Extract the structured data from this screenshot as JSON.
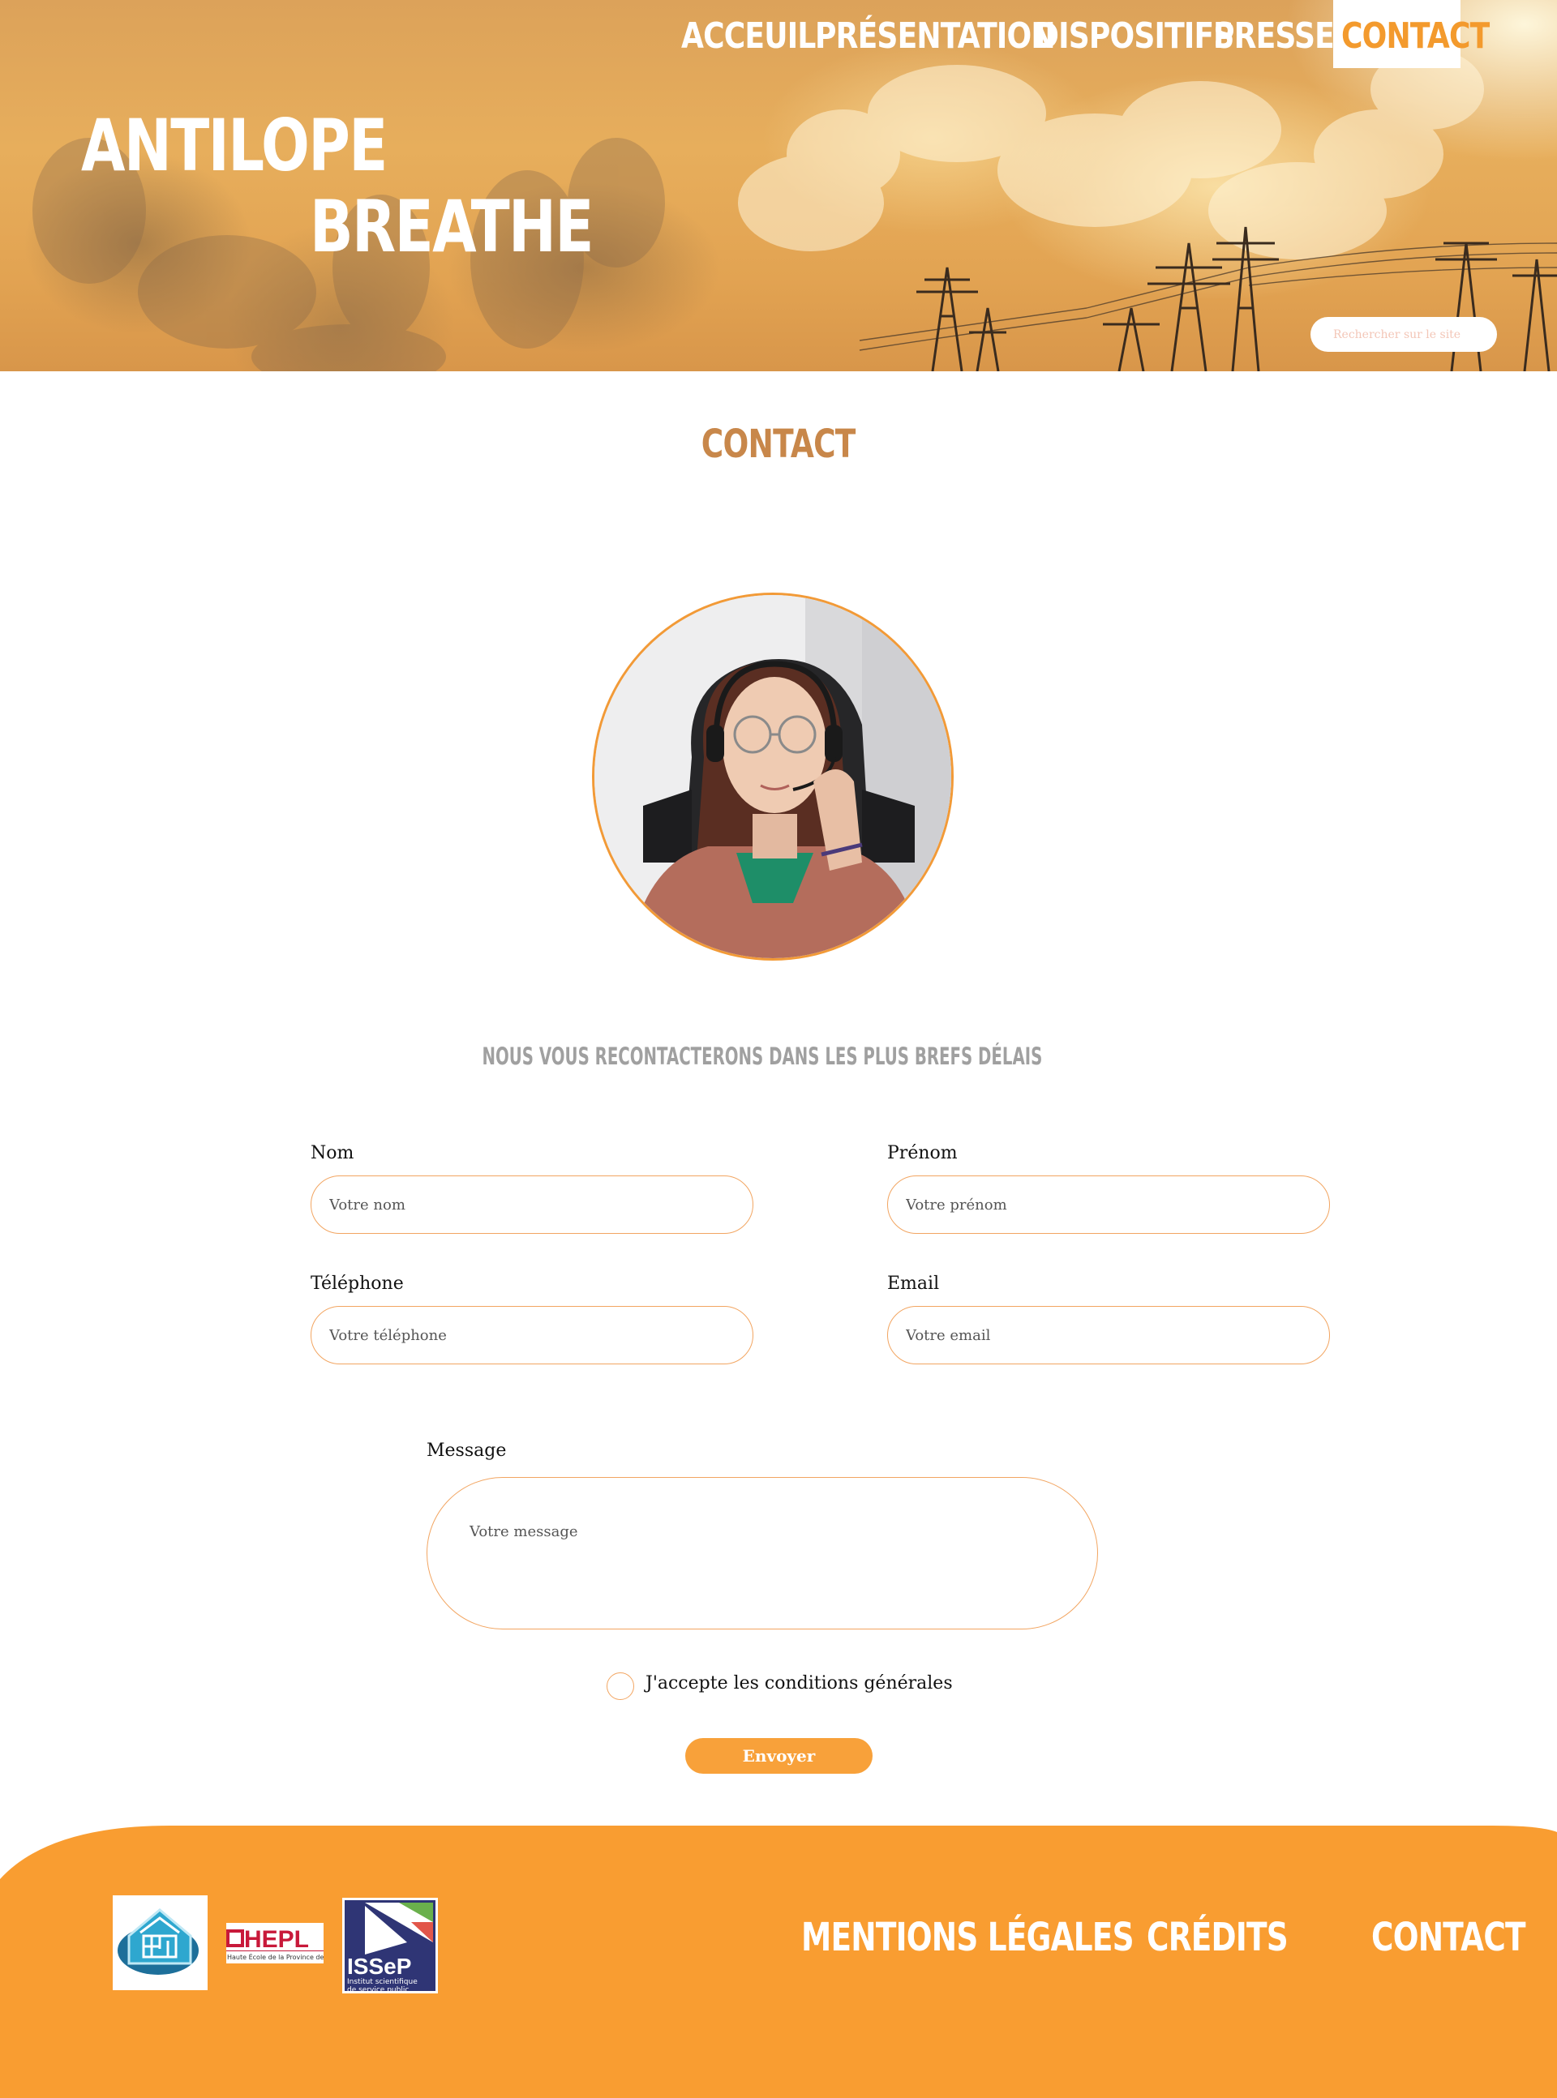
{
  "nav": {
    "items": [
      {
        "label": "ACCEUIL"
      },
      {
        "label": "PRÉSENTATION"
      },
      {
        "label": "DISPOSITIFS"
      },
      {
        "label": "PRESSE"
      },
      {
        "label": "CONTACT"
      }
    ],
    "active": "CONTACT"
  },
  "brand": {
    "line1": "ANTILOPE",
    "line2": "BREATHE"
  },
  "search": {
    "placeholder": "Rechercher sur le site"
  },
  "main": {
    "title": "CONTACT",
    "subtitle": "NOUS VOUS RECONTACTERONS DANS LES PLUS BREFS DÉLAIS"
  },
  "form": {
    "nom": {
      "label": "Nom",
      "placeholder": "Votre nom"
    },
    "prenom": {
      "label": "Prénom",
      "placeholder": "Votre prénom"
    },
    "telephone": {
      "label": "Téléphone",
      "placeholder": "Votre téléphone"
    },
    "email": {
      "label": "Email",
      "placeholder": "Votre email"
    },
    "message": {
      "label": "Message",
      "placeholder": "Votre message"
    },
    "terms_label": "J'accepte les conditions générales",
    "submit_label": "Envoyer"
  },
  "footer": {
    "logos": {
      "hepl": "HEPL",
      "hepl_tagline": "Haute École de la Province de Liège",
      "issep": "ISSeP",
      "issep_tagline": "Institut scientifique de service public"
    },
    "links": [
      {
        "label": "MENTIONS LÉGALES"
      },
      {
        "label": "CRÉDITS"
      },
      {
        "label": "CONTACT"
      }
    ]
  },
  "colors": {
    "accent": "#f39a2d",
    "footer_bg": "#f99d31",
    "title": "#c8874a",
    "subtitle": "#a0a0a0",
    "field_border": "#f2a561"
  }
}
